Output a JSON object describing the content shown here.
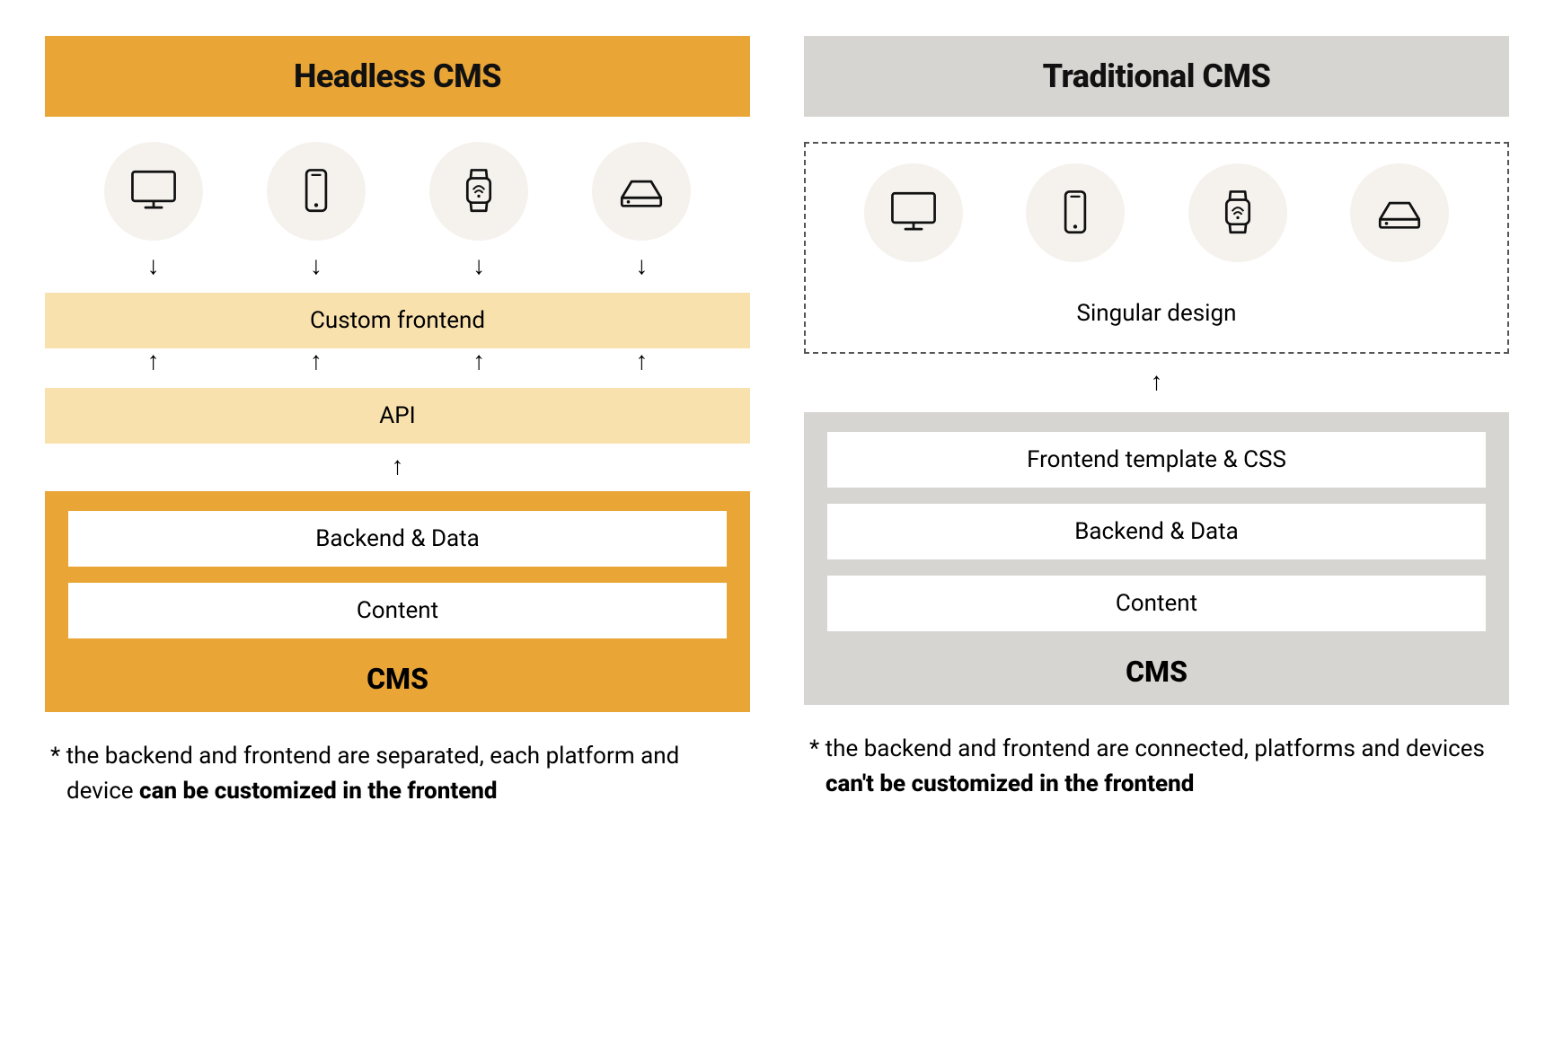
{
  "left": {
    "title": "Headless CMS",
    "devices": [
      "desktop",
      "phone",
      "watch",
      "server"
    ],
    "custom_frontend": "Custom frontend",
    "api": "API",
    "cms": {
      "backend": "Backend & Data",
      "content": "Content",
      "label": "CMS"
    },
    "footnote_prefix": "* the backend and frontend are separated, each platform and device ",
    "footnote_bold": "can be customized in the frontend"
  },
  "right": {
    "title": "Traditional CMS",
    "devices": [
      "desktop",
      "phone",
      "watch",
      "server"
    ],
    "singular_design": "Singular design",
    "cms": {
      "frontend": "Frontend template & CSS",
      "backend": "Backend & Data",
      "content": "Content",
      "label": "CMS"
    },
    "footnote_prefix": "* the backend and frontend are connected, platforms and devices ",
    "footnote_bold": "can't be customized in the frontend"
  },
  "arrows": {
    "down": "↓",
    "up": "↑"
  }
}
